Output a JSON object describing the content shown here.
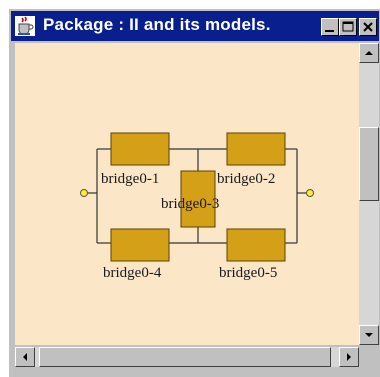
{
  "window": {
    "title": "Package : II and its models.",
    "icon": "java-cup-icon"
  },
  "diagram": {
    "bridges": [
      {
        "id": "bridge0-1",
        "label": "bridge0-1"
      },
      {
        "id": "bridge0-2",
        "label": "bridge0-2"
      },
      {
        "id": "bridge0-3",
        "label": "bridge0-3"
      },
      {
        "id": "bridge0-4",
        "label": "bridge0-4"
      },
      {
        "id": "bridge0-5",
        "label": "bridge0-5"
      }
    ],
    "colors": {
      "canvas": "#fbe6c7",
      "box_fill": "#d4a017",
      "box_border": "#5a4300",
      "wire": "#333333",
      "terminal": "#ffee22"
    }
  },
  "controls": {
    "minimize_icon": "minimize-icon",
    "maximize_icon": "maximize-icon",
    "close_icon": "close-icon"
  }
}
